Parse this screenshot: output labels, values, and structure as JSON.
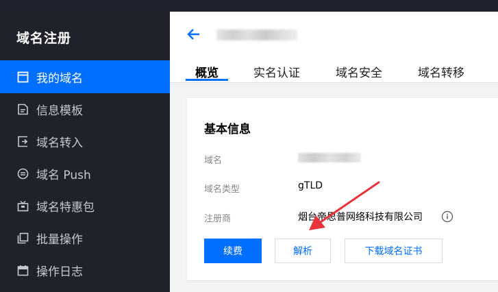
{
  "sidebar": {
    "title": "域名注册",
    "items": [
      {
        "label": "我的域名",
        "icon": "browser-window-icon",
        "active": true
      },
      {
        "label": "信息模板",
        "icon": "document-icon"
      },
      {
        "label": "域名转入",
        "icon": "transfer-in-icon"
      },
      {
        "label": "域名 Push",
        "icon": "push-circle-icon"
      },
      {
        "label": "域名特惠包",
        "icon": "gift-package-icon"
      },
      {
        "label": "批量操作",
        "icon": "batch-copy-icon"
      },
      {
        "label": "操作日志",
        "icon": "calendar-icon"
      }
    ]
  },
  "header": {
    "back_icon": "arrow-left-icon",
    "tabs": [
      {
        "label": "概览",
        "active": true
      },
      {
        "label": "实名认证"
      },
      {
        "label": "域名安全"
      },
      {
        "label": "域名转移"
      }
    ]
  },
  "card": {
    "title": "基本信息",
    "fields": [
      {
        "label": "域名",
        "value": ""
      },
      {
        "label": "域名类型",
        "value": "gTLD"
      },
      {
        "label": "注册商",
        "value": "烟台帝思普网络科技有限公司"
      }
    ],
    "info_icon": "info-circle-icon",
    "buttons": {
      "renew": "续费",
      "resolve": "解析",
      "download_cert": "下载域名证书"
    }
  },
  "annotation": {
    "arrow_color": "#e8333a",
    "arrow_icon": "red-arrow-annotation"
  },
  "colors": {
    "accent": "#006eff",
    "sidebar_bg": "#1f222b"
  }
}
